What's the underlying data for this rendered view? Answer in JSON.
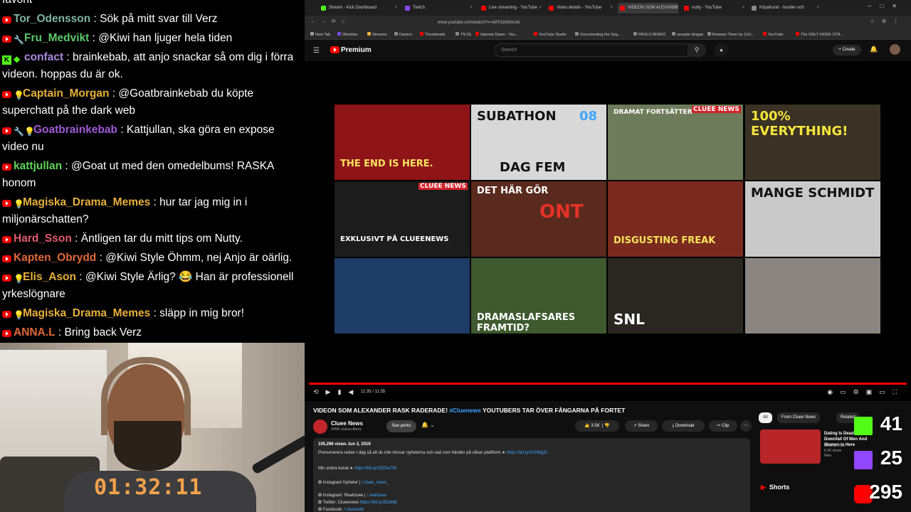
{
  "chat": {
    "partial_top": "favorit",
    "messages": [
      {
        "badges": [
          "yt"
        ],
        "user": "Tor_Odensson",
        "color": "#7fb3a3",
        "text": ": Sök på mitt svar till Verz"
      },
      {
        "badges": [
          "yt",
          "tool"
        ],
        "user": "Fru_Medvikt",
        "color": "#5cc96a",
        "text": ": @Kiwi han ljuger hela tiden"
      },
      {
        "badges": [
          "kick",
          "gem"
        ],
        "user": "confact",
        "color": "#a98be0",
        "text": ": brainkebab, att anjo snackar så om dig i förra videon. hoppas du är ok."
      },
      {
        "badges": [
          "yt",
          "bulb"
        ],
        "user": "Captain_Morgan",
        "color": "#e7b03c",
        "text": ": @Goatbrainkebab du köpte superchatt på the dark web"
      },
      {
        "badges": [
          "yt",
          "tool",
          "bulb"
        ],
        "user": "Goatbrainkebab",
        "color": "#a05ad9",
        "text": ": Kattjullan, ska göra en expose video nu"
      },
      {
        "badges": [
          "yt"
        ],
        "user": "kattjullan",
        "color": "#5fd35a",
        "text": ": @Goat ut med den omedelbums! RASKA honom"
      },
      {
        "badges": [
          "yt",
          "bulb"
        ],
        "user": "Magiska_Drama_Memes",
        "color": "#e7b03c",
        "text": ": hur tar jag mig in i miljonärschatten?"
      },
      {
        "badges": [
          "yt"
        ],
        "user": "Hard_Sson",
        "color": "#e05a6b",
        "text": ": Äntligen tar du mitt tips om Nutty."
      },
      {
        "badges": [
          "yt"
        ],
        "user": "Kapten_Obrydd",
        "color": "#e0683a",
        "text": ": @Kiwi Style Öhmm, nej Anjo är oärlig."
      },
      {
        "badges": [
          "yt",
          "bulb"
        ],
        "user": "Elis_Ason",
        "color": "#e7b03c",
        "text": ": @Kiwi Style Ärlig? 😂 Han är professionell yrkeslögnare"
      },
      {
        "badges": [
          "yt",
          "bulb"
        ],
        "user": "Magiska_Drama_Memes",
        "color": "#e7b03c",
        "text": ": släpp in mig bror!"
      },
      {
        "badges": [
          "yt"
        ],
        "user": "ANNA.L",
        "color": "#e0683a",
        "text": ": Bring back Verz"
      }
    ]
  },
  "webcam": {
    "timer": "01:32:11"
  },
  "browser": {
    "tabs": [
      {
        "label": "Stream - Kick Dashboard",
        "color": "#53fc18"
      },
      {
        "label": "Twitch",
        "color": "#9146ff"
      },
      {
        "label": "Live streaming - YouTube",
        "color": "#f00"
      },
      {
        "label": "Video details - YouTube",
        "color": "#f00"
      },
      {
        "label": "VIDEON SOM ALEXANDE",
        "color": "#f00"
      },
      {
        "label": "nutty - YouTube",
        "color": "#f00"
      },
      {
        "label": "Köpahund - hunder och",
        "color": "#888"
      }
    ],
    "url": "www.youtube.com/watch?v=sM7d1kNmLkk",
    "bookmarks": [
      {
        "label": "New Tab",
        "color": "#999"
      },
      {
        "label": "Obsidian",
        "color": "#7b4ae0"
      },
      {
        "label": "Streams",
        "color": "#e7b03c"
      },
      {
        "label": "Davinci",
        "color": "#888"
      },
      {
        "label": "Thumbnails",
        "color": "#f00"
      },
      {
        "label": "TN DL",
        "color": "#888"
      },
      {
        "label": "Harvest Dawn - You...",
        "color": "#f00"
      },
      {
        "label": "YouTube Studio",
        "color": "#f00"
      },
      {
        "label": "Documenting the Seg...",
        "color": "#888"
      },
      {
        "label": "PAOLO-BINGO",
        "color": "#888"
      },
      {
        "label": "senaste bingan",
        "color": "#888"
      },
      {
        "label": "Browser Timer by Coli...",
        "color": "#888"
      },
      {
        "label": "YouTube",
        "color": "#f00"
      },
      {
        "label": "The ONLY NODE STR...",
        "color": "#f00"
      }
    ]
  },
  "youtube": {
    "brand": "Premium",
    "search_placeholder": "Search",
    "create_label": "+ Create",
    "thumbnails": [
      {
        "text": "THE END IS HERE.",
        "sub": "",
        "bg": "#8e1418",
        "color": "#f7e35c"
      },
      {
        "text": "SUBATHON",
        "sub": "DAG FEM",
        "bg": "#d8d8d8",
        "color": "#111"
      },
      {
        "text": "DRAMAT FORTSÄTTER",
        "sub": "CLUEE NEWS",
        "bg": "#6e7b5a",
        "color": "#fff"
      },
      {
        "text": "100% EVERYTHING!",
        "sub": "",
        "bg": "#3a3225",
        "color": "#f5e63b"
      },
      {
        "text": "EXKLUSIVT PÅ CLUEENEWS",
        "sub": "CLUEE NEWS",
        "bg": "#1c1c1c",
        "color": "#fff"
      },
      {
        "text": "DET HÄR GÖR",
        "sub": "ONT",
        "bg": "#5a2a1e",
        "color": "#fff"
      },
      {
        "text": "DISGUSTING FREAK",
        "sub": "",
        "bg": "#7a2a1e",
        "color": "#f7e35c"
      },
      {
        "text": "MANGE SCHMIDT",
        "sub": "",
        "bg": "#c9c9c9",
        "color": "#111"
      },
      {
        "text": "",
        "sub": "",
        "bg": "#1d3c66",
        "color": "#fff"
      },
      {
        "text": "DRAMASLAFSARES FRAMTID?",
        "sub": "",
        "bg": "#3e5a2e",
        "color": "#fff"
      },
      {
        "text": "SNL",
        "sub": "",
        "bg": "#2a2620",
        "color": "#fff"
      },
      {
        "text": "",
        "sub": "",
        "bg": "#8a8580",
        "color": "#fff"
      }
    ],
    "subathon_num": "08",
    "time": "11:35 / 11:35",
    "title_main": "VIDEON SOM ALEXANDER RASK RADERADE! ",
    "title_tag": "#Cluenews",
    "title_rest": " YOUTUBERS TAR ÖVER FÅNGARNA PÅ FORTET",
    "channel": "Cluee News",
    "subscribers": "245K subscribers",
    "perks_label": "See perks",
    "likes": "3.5K",
    "share_label": "Share",
    "download_label": "Download",
    "clip_label": "Clip",
    "views_date": "105,296 views  Jun 3, 2019",
    "desc_lines": [
      {
        "text": "Prenumerera redan i dag så att du inte missar nyheterna och vad som händer på våran plattform  ➤  ",
        "link": "https://bit.ly/2U0Mg2L"
      },
      {
        "text": "Min andra kanal ➤ ",
        "link": "https://bit.ly/2Q03e7W"
      },
      {
        "text": "✪ Instagram Nyheter | ",
        "link": "/ cluee_news_"
      },
      {
        "text": "✪ Instagram: Realcluee | ",
        "link": "/ realcluee"
      },
      {
        "text": "✪ Twitter: Clueenews ",
        "link": "https://bit.ly/2Exbl8I"
      },
      {
        "text": "✪ Facebook: ",
        "link": "/ cluenede"
      }
    ],
    "chips": [
      "All",
      "From Cluee News",
      "Related"
    ],
    "side_video": {
      "title": "Dating Is Dead: The Downfall Of Men And Women Is Here",
      "channel": "Destiny DSG",
      "views": "6.2K views",
      "duration": "26:21",
      "badge": "New"
    },
    "shorts_label": "Shorts"
  },
  "counters": [
    {
      "platform": "kick-icon",
      "value": "41",
      "color": "#53fc18"
    },
    {
      "platform": "twitch-icon",
      "value": "25",
      "color": "#9146ff"
    },
    {
      "platform": "youtube-icon",
      "value": "295",
      "color": "#f00"
    }
  ]
}
